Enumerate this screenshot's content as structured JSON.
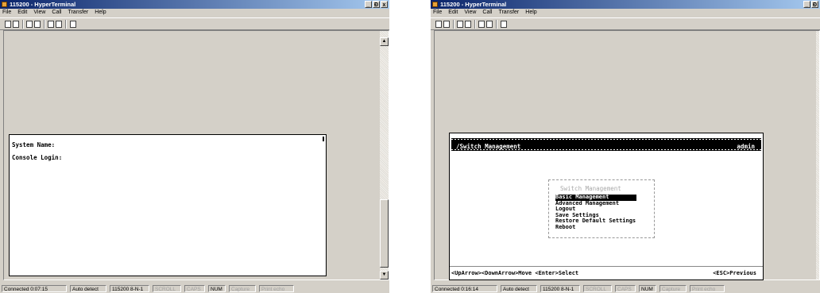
{
  "left": {
    "title": "115200 - HyperTerminal",
    "window_buttons": [
      "_",
      "Ɖ",
      "x"
    ],
    "menu": [
      "File",
      "Edit",
      "View",
      "Call",
      "Transfer",
      "Help"
    ],
    "terminal_lines": [
      "System Name:",
      "Console Login:"
    ],
    "status": {
      "connected": "Connected 0:07:15",
      "detect": "Auto detect",
      "port": "115200 8-N-1",
      "scroll": "SCROLL",
      "caps": "CAPS",
      "num": "NUM",
      "capture": "Capture",
      "print": "Print echo"
    }
  },
  "right": {
    "title": "115200 - HyperTerminal",
    "window_buttons": [
      "_",
      "Ɖ"
    ],
    "menu": [
      "File",
      "Edit",
      "View",
      "Call",
      "Transfer",
      "Help"
    ],
    "header_path": "/Switch Management",
    "header_user": "admin",
    "menu_title": "Switch Management",
    "menu_options": [
      "Basic Management",
      "Advanced Management",
      "Logout",
      "Save Settings",
      "Restore Default Settings",
      "Reboot"
    ],
    "footer_left": "<UpArrow><DownArrow>Move  <Enter>Select",
    "footer_right": "<ESC>Previous",
    "status": {
      "connected": "Connected 0:16:14",
      "detect": "Auto detect",
      "port": "115200 8-N-1",
      "scroll": "SCROLL",
      "caps": "CAPS",
      "num": "NUM",
      "capture": "Capture",
      "print": "Print echo"
    }
  },
  "icons": [
    "new-icon",
    "open-icon",
    "connect-icon",
    "disconnect-icon",
    "send-icon",
    "receive-icon",
    "properties-icon"
  ],
  "colors": {
    "title_start": "#0a246a",
    "title_end": "#a6caf0",
    "window_bg": "#d4d0c8"
  }
}
